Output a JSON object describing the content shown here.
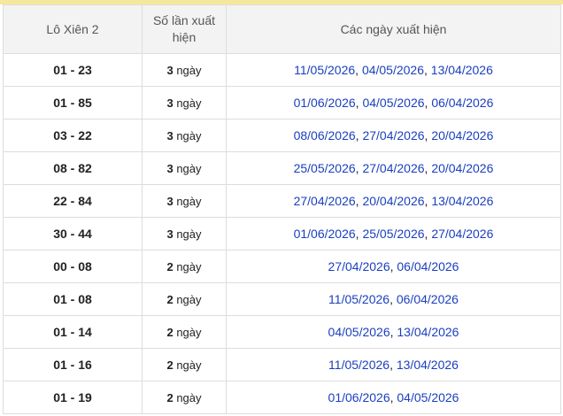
{
  "table": {
    "headers": [
      "Lô Xiên 2",
      "Số lần xuất hiện",
      "Các ngày xuất hiện"
    ],
    "unit": "ngày",
    "rows": [
      {
        "pair": "01 - 23",
        "count": "3",
        "dates": [
          "11/05/2026",
          "04/05/2026",
          "13/04/2026"
        ]
      },
      {
        "pair": "01 - 85",
        "count": "3",
        "dates": [
          "01/06/2026",
          "04/05/2026",
          "06/04/2026"
        ]
      },
      {
        "pair": "03 - 22",
        "count": "3",
        "dates": [
          "08/06/2026",
          "27/04/2026",
          "20/04/2026"
        ]
      },
      {
        "pair": "08 - 82",
        "count": "3",
        "dates": [
          "25/05/2026",
          "27/04/2026",
          "20/04/2026"
        ]
      },
      {
        "pair": "22 - 84",
        "count": "3",
        "dates": [
          "27/04/2026",
          "20/04/2026",
          "13/04/2026"
        ]
      },
      {
        "pair": "30 - 44",
        "count": "3",
        "dates": [
          "01/06/2026",
          "25/05/2026",
          "27/04/2026"
        ]
      },
      {
        "pair": "00 - 08",
        "count": "2",
        "dates": [
          "27/04/2026",
          "06/04/2026"
        ]
      },
      {
        "pair": "01 - 08",
        "count": "2",
        "dates": [
          "11/05/2026",
          "06/04/2026"
        ]
      },
      {
        "pair": "01 - 14",
        "count": "2",
        "dates": [
          "04/05/2026",
          "13/04/2026"
        ]
      },
      {
        "pair": "01 - 16",
        "count": "2",
        "dates": [
          "11/05/2026",
          "13/04/2026"
        ]
      },
      {
        "pair": "01 - 19",
        "count": "2",
        "dates": [
          "01/06/2026",
          "04/05/2026"
        ]
      }
    ]
  },
  "colors": {
    "link": "#1a3fbf",
    "header_bg": "#f3f3f3",
    "top_bar": "#f7e79a",
    "border": "#dddddd"
  }
}
